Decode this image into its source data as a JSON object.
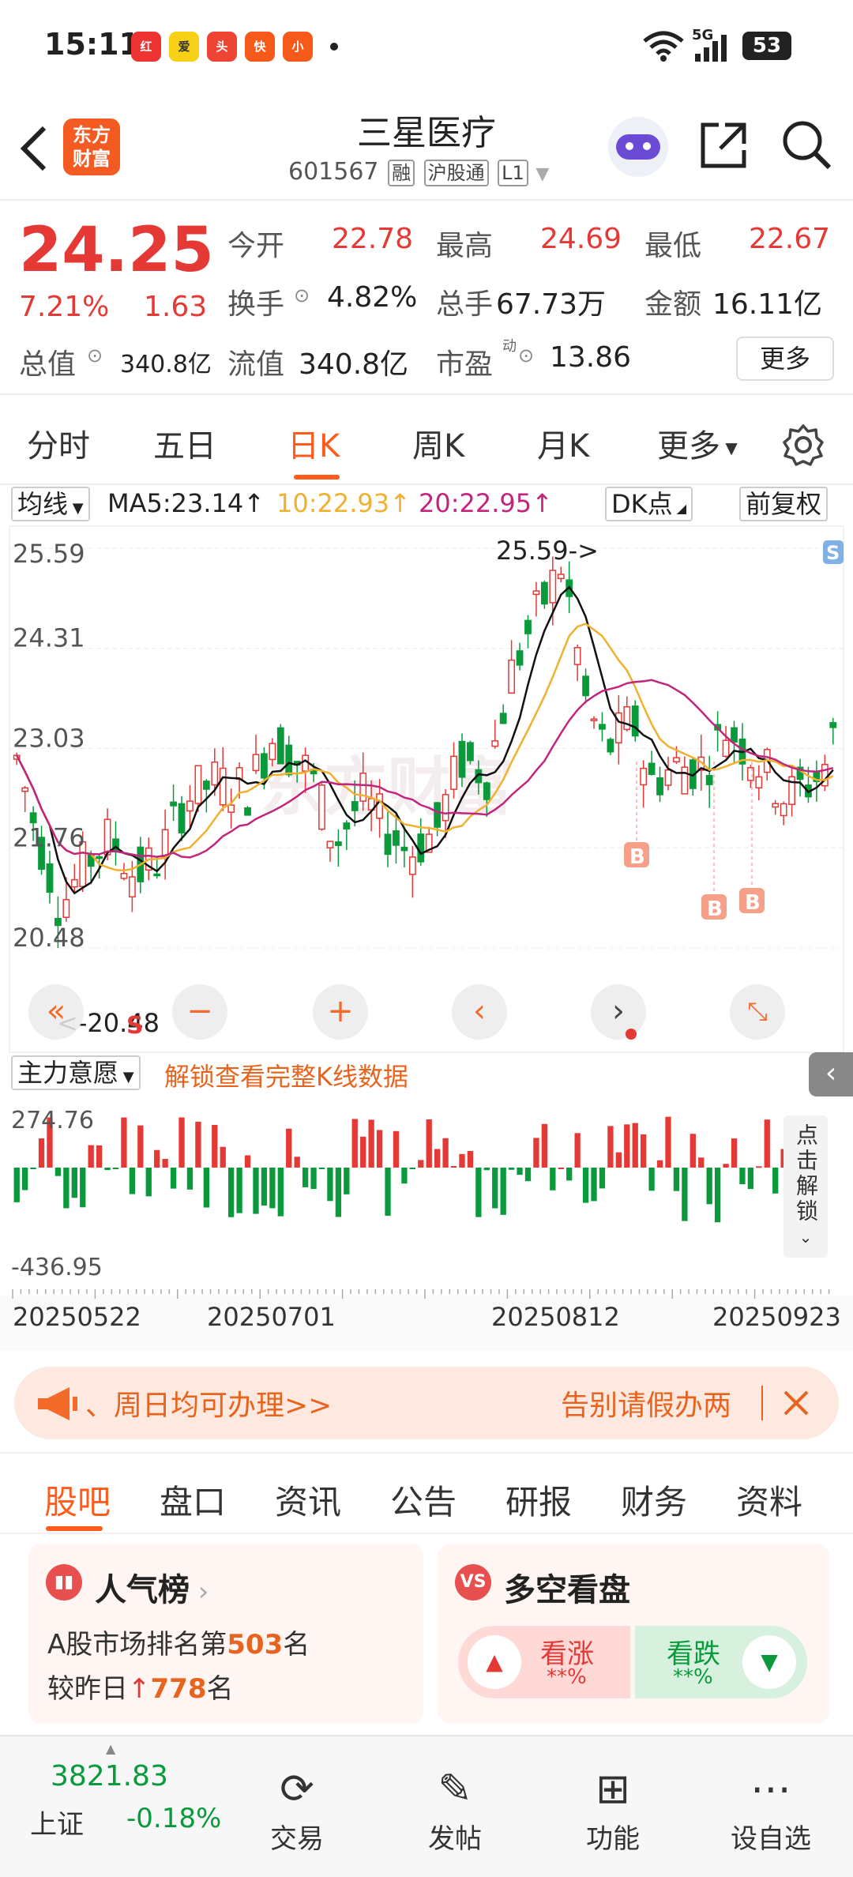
{
  "status_bar": {
    "time": "15:11",
    "signal": "5G",
    "battery": "53",
    "app_icons": [
      "红包",
      "爱奇艺",
      "头条",
      "快手",
      "小红书"
    ]
  },
  "header": {
    "logo_line1": "东方",
    "logo_line2": "财富",
    "title": "三星医疗",
    "code": "601567",
    "tags": [
      "融",
      "沪股通",
      "L1"
    ]
  },
  "quote": {
    "price": "24.25",
    "change_pct": "7.21%",
    "change": "1.63",
    "open_label": "今开",
    "open": "22.78",
    "high_label": "最高",
    "high": "24.69",
    "low_label": "最低",
    "low": "22.67",
    "turnover_label": "换手",
    "turnover": "4.82%",
    "volume_label": "总手",
    "volume": "67.73万",
    "amount_label": "金额",
    "amount": "16.11亿",
    "mktcap_label": "总值",
    "mktcap": "340.8亿",
    "float_label": "流值",
    "float": "340.8亿",
    "pe_label": "市盈",
    "pe_sup": "动",
    "pe": "13.86",
    "more": "更多"
  },
  "period_tabs": [
    "分时",
    "五日",
    "日K",
    "周K",
    "月K",
    "更多"
  ],
  "active_period": "日K",
  "ma_row": {
    "select": "均线",
    "ma5": "MA5:23.14↑",
    "ma10": "10:22.93↑",
    "ma20": "20:22.95↑",
    "dk": "DK点",
    "adjust": "前复权"
  },
  "colors": {
    "up": "#e53935",
    "down": "#0a9a3c",
    "ma5": "#111111",
    "ma10": "#f0b030",
    "ma20": "#c2257d",
    "accent": "#ff5b1a"
  },
  "chart_data": {
    "type": "candlestick",
    "y_ticks": [
      "25.59",
      "24.31",
      "23.03",
      "21.76",
      "20.48"
    ],
    "ylim": [
      20.48,
      25.59
    ],
    "annotations": {
      "max_label": "25.59->",
      "min_label": "<-20.48",
      "signals": [
        "B",
        "B",
        "B",
        "S",
        "S"
      ]
    },
    "x_labels": [
      "20250522",
      "20250701",
      "20250812",
      "20250923"
    ],
    "indicator": {
      "select": "主力意愿",
      "lock_text": "解锁查看完整K线数据",
      "max": "274.76",
      "min": "-436.95",
      "side": "点击解锁"
    }
  },
  "banner": {
    "left": "、周日均可办理>>",
    "right": "告别请假办两"
  },
  "content_tabs": [
    "股吧",
    "盘口",
    "资讯",
    "公告",
    "研报",
    "财务",
    "资料"
  ],
  "cards": {
    "popular": {
      "title": "人气榜",
      "line1_pre": "A股市场排名第",
      "rank": "503",
      "line1_post": "名",
      "line2_pre": "较昨日",
      "delta": "778",
      "line2_post": "名"
    },
    "sentiment": {
      "title": "多空看盘",
      "bull": "看涨",
      "bull_pct": "**%",
      "bear": "看跌",
      "bear_pct": "**%"
    }
  },
  "bottom_nav": {
    "index_value": "3821.83",
    "index_name": "上证",
    "index_change": "-0.18%",
    "items": [
      "交易",
      "发帖",
      "功能",
      "设自选"
    ]
  }
}
